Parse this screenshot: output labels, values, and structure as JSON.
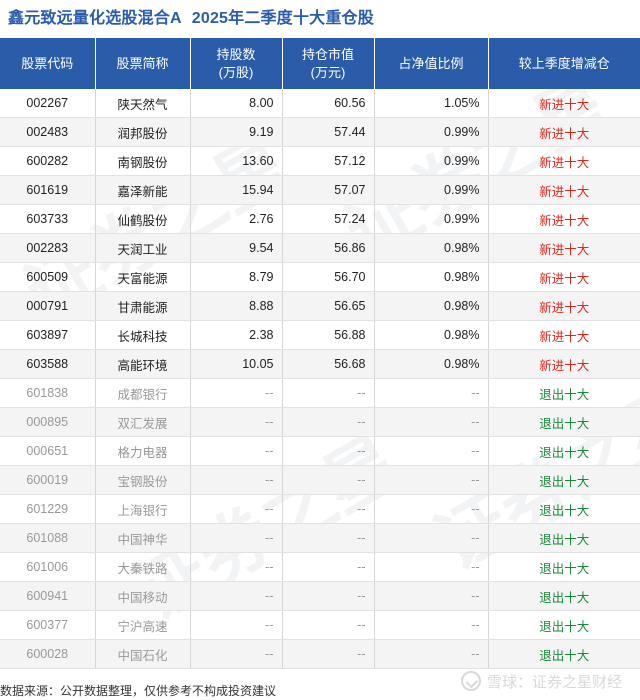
{
  "title": {
    "fund_name": "鑫元致远量化选股混合A",
    "subtitle": "2025年二季度十大重仓股"
  },
  "table": {
    "headers": {
      "code": "股票代码",
      "name": "股票简称",
      "shares": "持股数(万股)",
      "value": "持仓市值(万元)",
      "ratio": "占净值比例",
      "change": "较上季度增减仓"
    },
    "rows": [
      {
        "code": "002267",
        "name": "陕天然气",
        "shares": "8.00",
        "value": "60.56",
        "ratio": "1.05%",
        "change": "新进十大",
        "status": "new"
      },
      {
        "code": "002483",
        "name": "润邦股份",
        "shares": "9.19",
        "value": "57.44",
        "ratio": "0.99%",
        "change": "新进十大",
        "status": "new"
      },
      {
        "code": "600282",
        "name": "南钢股份",
        "shares": "13.60",
        "value": "57.12",
        "ratio": "0.99%",
        "change": "新进十大",
        "status": "new"
      },
      {
        "code": "601619",
        "name": "嘉泽新能",
        "shares": "15.94",
        "value": "57.07",
        "ratio": "0.99%",
        "change": "新进十大",
        "status": "new"
      },
      {
        "code": "603733",
        "name": "仙鹤股份",
        "shares": "2.76",
        "value": "57.24",
        "ratio": "0.99%",
        "change": "新进十大",
        "status": "new"
      },
      {
        "code": "002283",
        "name": "天润工业",
        "shares": "9.54",
        "value": "56.86",
        "ratio": "0.98%",
        "change": "新进十大",
        "status": "new"
      },
      {
        "code": "600509",
        "name": "天富能源",
        "shares": "8.79",
        "value": "56.70",
        "ratio": "0.98%",
        "change": "新进十大",
        "status": "new"
      },
      {
        "code": "000791",
        "name": "甘肃能源",
        "shares": "8.88",
        "value": "56.65",
        "ratio": "0.98%",
        "change": "新进十大",
        "status": "new"
      },
      {
        "code": "603897",
        "name": "长城科技",
        "shares": "2.38",
        "value": "56.88",
        "ratio": "0.98%",
        "change": "新进十大",
        "status": "new"
      },
      {
        "code": "603588",
        "name": "高能环境",
        "shares": "10.05",
        "value": "56.68",
        "ratio": "0.98%",
        "change": "新进十大",
        "status": "new"
      },
      {
        "code": "601838",
        "name": "成都银行",
        "shares": "--",
        "value": "--",
        "ratio": "--",
        "change": "退出十大",
        "status": "out"
      },
      {
        "code": "000895",
        "name": "双汇发展",
        "shares": "--",
        "value": "--",
        "ratio": "--",
        "change": "退出十大",
        "status": "out"
      },
      {
        "code": "000651",
        "name": "格力电器",
        "shares": "--",
        "value": "--",
        "ratio": "--",
        "change": "退出十大",
        "status": "out"
      },
      {
        "code": "600019",
        "name": "宝钢股份",
        "shares": "--",
        "value": "--",
        "ratio": "--",
        "change": "退出十大",
        "status": "out"
      },
      {
        "code": "601229",
        "name": "上海银行",
        "shares": "--",
        "value": "--",
        "ratio": "--",
        "change": "退出十大",
        "status": "out"
      },
      {
        "code": "601088",
        "name": "中国神华",
        "shares": "--",
        "value": "--",
        "ratio": "--",
        "change": "退出十大",
        "status": "out"
      },
      {
        "code": "601006",
        "name": "大秦铁路",
        "shares": "--",
        "value": "--",
        "ratio": "--",
        "change": "退出十大",
        "status": "out"
      },
      {
        "code": "600941",
        "name": "中国移动",
        "shares": "--",
        "value": "--",
        "ratio": "--",
        "change": "退出十大",
        "status": "out"
      },
      {
        "code": "600377",
        "name": "宁沪高速",
        "shares": "--",
        "value": "--",
        "ratio": "--",
        "change": "退出十大",
        "status": "out"
      },
      {
        "code": "600028",
        "name": "中国石化",
        "shares": "--",
        "value": "--",
        "ratio": "--",
        "change": "退出十大",
        "status": "out"
      }
    ]
  },
  "footer": {
    "source": "数据来源：公开数据整理，仅供参考不构成投资建议"
  },
  "watermark": {
    "text": "证券之星",
    "brand": "雪球：证券之星财经",
    "brand_icon": "snowball-icon"
  },
  "colors": {
    "accent": "#2a5caa",
    "new_entry": "#e0281e",
    "exit": "#1a8a3c"
  }
}
